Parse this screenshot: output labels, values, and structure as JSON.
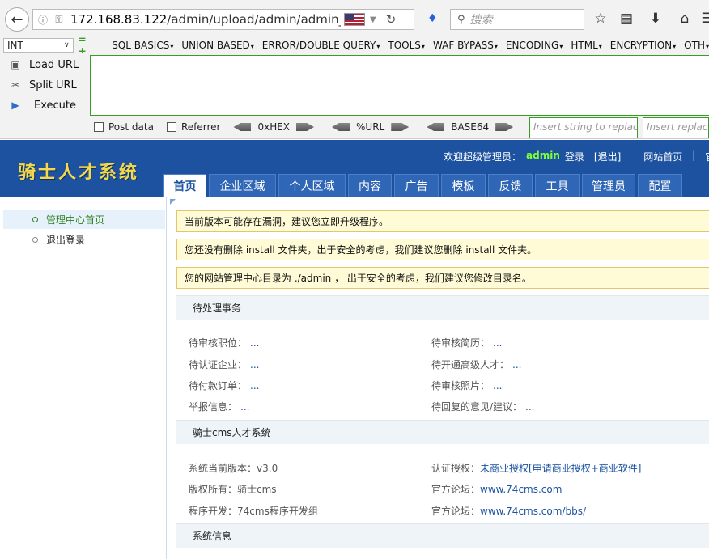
{
  "browser": {
    "url_prefix": "172.168.83.122",
    "url_path": "/admin/upload/admin/admin_inde:",
    "search_placeholder": "搜索"
  },
  "hackbar": {
    "select_value": "INT",
    "pm": "= +",
    "menu": [
      "SQL BASICS",
      "UNION BASED",
      "ERROR/DOUBLE QUERY",
      "TOOLS",
      "WAF BYPASS",
      "ENCODING",
      "HTML",
      "ENCRYPTION",
      "OTH"
    ],
    "load_url": "Load URL",
    "split_url": "Split URL",
    "execute": "Execute",
    "post_data": "Post data",
    "referrer": "Referrer",
    "enc_hex": "0xHEX",
    "enc_url": "%URL",
    "enc_base64": "BASE64",
    "insert_placeholder": "Insert string to replace",
    "replacing_placeholder": "Insert replacin"
  },
  "header": {
    "logo": "骑士人才系统",
    "welcome": "欢迎超级管理员：",
    "admin": "admin",
    "login": "登录",
    "logout": "[退出]",
    "site_home": "网站首页",
    "sep": "|",
    "official": "官方"
  },
  "nav": [
    "首页",
    "企业区域",
    "个人区域",
    "内容",
    "广告",
    "模板",
    "反馈",
    "工具",
    "管理员",
    "配置"
  ],
  "sidebar": [
    "管理中心首页",
    "退出登录"
  ],
  "notices": [
    "当前版本可能存在漏洞，建议您立即升级程序。",
    "您还没有删除 install 文件夹，出于安全的考虑，我们建议您删除 install 文件夹。",
    "您的网站管理中心目录为 ./admin ， 出于安全的考虑，我们建议您修改目录名。"
  ],
  "pending": {
    "title": "待处理事务",
    "items": [
      {
        "label": "待审核职位：",
        "value": "..."
      },
      {
        "label": "待审核简历：",
        "value": "..."
      },
      {
        "label": "待认证企业：",
        "value": "..."
      },
      {
        "label": "待开通高级人才：",
        "value": "..."
      },
      {
        "label": "待付款订单：",
        "value": "..."
      },
      {
        "label": "待审核照片：",
        "value": "..."
      },
      {
        "label": "举报信息：",
        "value": "..."
      },
      {
        "label": "待回复的意见/建议：",
        "value": "..."
      }
    ]
  },
  "system": {
    "title": "骑士cms人才系统",
    "version_label": "系统当前版本：",
    "version": "v3.0",
    "auth_label": "认证授权：",
    "auth_value": "未商业授权[申请商业授权+商业软件]",
    "copyright_label": "版权所有：",
    "copyright": "骑士cms",
    "forum_label": "官方论坛：",
    "forum_url": "www.74cms.com",
    "dev_label": "程序开发：",
    "dev": "74cms程序开发组",
    "forum2_label": "官方论坛：",
    "forum2_url": "www.74cms.com/bbs/"
  },
  "sysinfo": {
    "title": "系统信息"
  },
  "colors": {
    "header_bg": "#1c52a0",
    "logo": "#f5d94a",
    "admin_name": "#7fff3a",
    "notice_bg": "#fffbd6"
  }
}
